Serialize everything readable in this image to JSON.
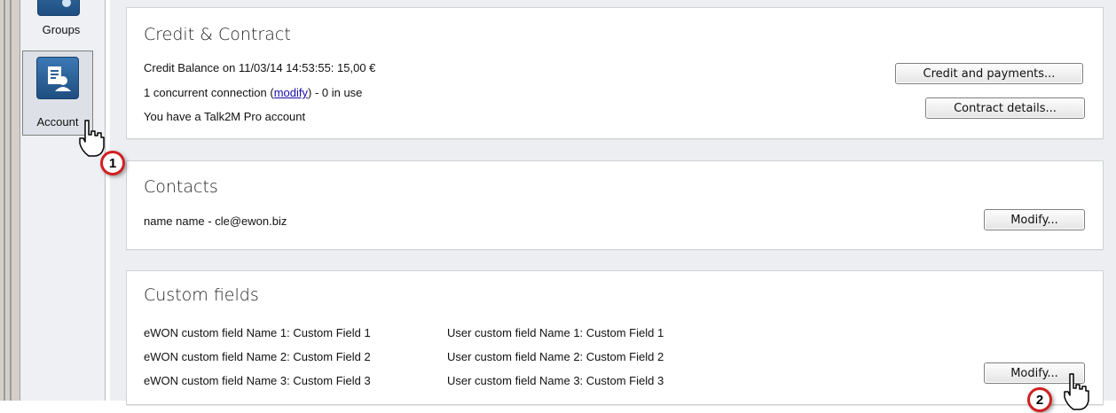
{
  "sidebar": {
    "items": [
      {
        "label": "Groups"
      },
      {
        "label": "Account"
      }
    ]
  },
  "credit": {
    "title": "Credit & Contract",
    "balance_text": "Credit Balance on 11/03/14 14:53:55: 15,00 €",
    "connections_prefix": "1 concurrent connection  (",
    "modify_link": "modify",
    "connections_suffix": ")  - 0 in use",
    "account_type": "You have a Talk2M Pro account",
    "credit_button": "Credit and payments...",
    "contract_button": "Contract details..."
  },
  "contacts": {
    "title": "Contacts",
    "contact_line": "name name  - cle@ewon.biz",
    "modify_button": "Modify..."
  },
  "custom_fields": {
    "title": "Custom fields",
    "ewon": [
      "eWON custom field Name 1: Custom Field 1",
      "eWON custom field Name 2: Custom Field 2",
      "eWON custom field Name 3: Custom Field 3"
    ],
    "user": [
      "User custom field Name 1: Custom Field 1",
      "User custom field Name 2: Custom Field 2",
      "User custom field Name 3: Custom Field 3"
    ],
    "modify_button": "Modify..."
  },
  "annotations": {
    "step1": "1",
    "step2": "2"
  },
  "colors": {
    "tile": "#2b5f96",
    "badge_ring": "#d02020",
    "link": "#1a0dab"
  }
}
